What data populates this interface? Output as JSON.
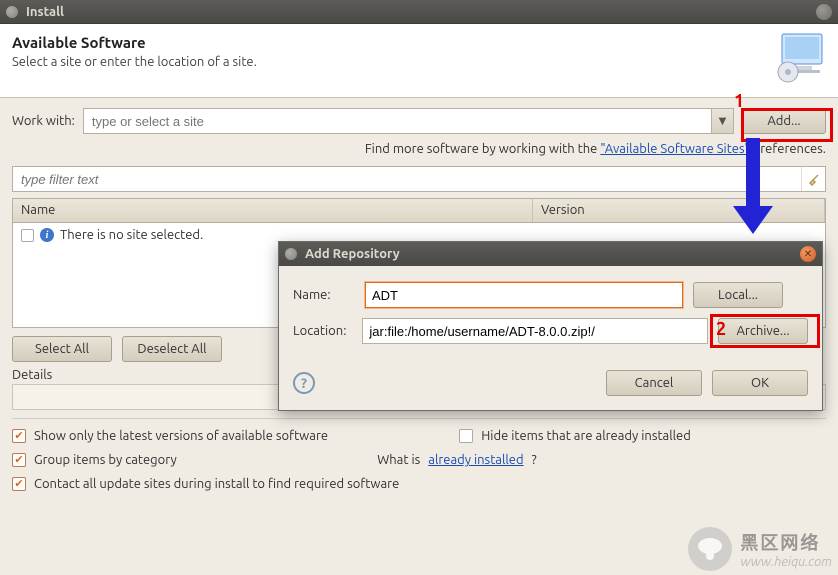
{
  "window": {
    "title": "Install"
  },
  "header": {
    "title": "Available Software",
    "subtitle": "Select a site or enter the location of a site."
  },
  "workwith": {
    "label": "Work with:",
    "placeholder": "type or select a site",
    "add_label": "Add..."
  },
  "find_more": {
    "prefix": "Find more software by working with the ",
    "link": "\"Available Software Sites\"",
    "suffix": " preferences."
  },
  "filter": {
    "placeholder": "type filter text"
  },
  "table": {
    "cols": {
      "name": "Name",
      "version": "Version"
    },
    "empty_text": "There is no site selected."
  },
  "buttons": {
    "select_all": "Select All",
    "deselect_all": "Deselect All"
  },
  "details_label": "Details",
  "checks": {
    "latest": "Show only the latest versions of available software",
    "group": "Group items by category",
    "contact": "Contact all update sites during install to find required software",
    "hide": "Hide items that are already installed",
    "what_is_prefix": "What is ",
    "what_is_link": "already installed",
    "what_is_suffix": "?"
  },
  "dialog": {
    "title": "Add Repository",
    "name_label": "Name:",
    "name_value": "ADT",
    "local_label": "Local...",
    "location_label": "Location:",
    "location_value": "jar:file:/home/username/ADT-8.0.0.zip!/",
    "archive_label": "Archive...",
    "cancel": "Cancel",
    "ok": "OK"
  },
  "annotations": {
    "one": "1",
    "two": "2"
  },
  "watermark": {
    "cn": "黑区网络",
    "dom": "www.heiqu.com"
  }
}
